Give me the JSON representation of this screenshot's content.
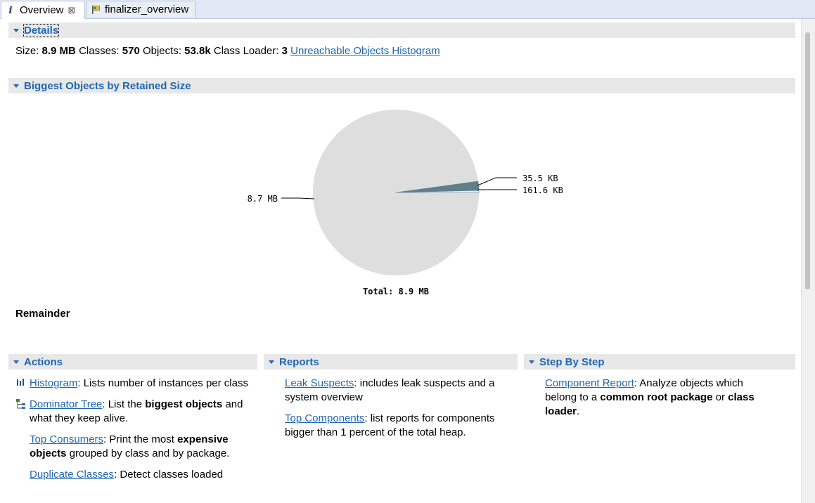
{
  "tabs": [
    {
      "label": "Overview",
      "icon": "info-icon",
      "active": true
    },
    {
      "label": "finalizer_overview",
      "icon": "query-icon",
      "active": false
    }
  ],
  "details": {
    "header": "Details",
    "size_label": "Size:",
    "size_value": "8.9 MB",
    "classes_label": "Classes:",
    "classes_value": "570",
    "objects_label": "Objects:",
    "objects_value": "53.8k",
    "loader_label": "Class Loader:",
    "loader_value": "3",
    "unreachable_link": "Unreachable Objects Histogram"
  },
  "biggest": {
    "header": "Biggest Objects by Retained Size",
    "remainder": "Remainder"
  },
  "chart_data": {
    "type": "pie",
    "unit": "KB",
    "slices": [
      {
        "label": "8.7 MB",
        "value": 8911,
        "color": "#dedede"
      },
      {
        "label": "35.5 KB",
        "value": 35.5,
        "color": "#e4eef0"
      },
      {
        "label": "161.6 KB",
        "value": 161.6,
        "color": "#5f7f8a"
      }
    ],
    "total_label": "Total: 8.9 MB"
  },
  "actions": {
    "header": "Actions",
    "items": [
      {
        "link": "Histogram",
        "desc": ": Lists number of instances per class",
        "icon": "histogram-icon"
      },
      {
        "link": "Dominator Tree",
        "desc_pre": ": List the ",
        "bold": "biggest objects",
        "desc_post": " and what they keep alive.",
        "icon": "dominator-tree-icon"
      },
      {
        "link": "Top Consumers",
        "desc_pre": ": Print the most ",
        "bold": "expensive objects",
        "desc_post": " grouped by class and by package."
      },
      {
        "link": "Duplicate Classes",
        "desc": ": Detect classes loaded"
      }
    ]
  },
  "reports": {
    "header": "Reports",
    "items": [
      {
        "link": "Leak Suspects",
        "desc": ": includes leak suspects and a system overview"
      },
      {
        "link": "Top Components",
        "desc": ": list reports for components bigger than 1 percent of the total heap."
      }
    ]
  },
  "stepbystep": {
    "header": "Step By Step",
    "items": [
      {
        "link": "Component Report",
        "desc_pre": ": Analyze objects which belong to a ",
        "bold1": "common root package",
        "mid": " or ",
        "bold2": "class loader",
        "desc_post": "."
      }
    ]
  }
}
